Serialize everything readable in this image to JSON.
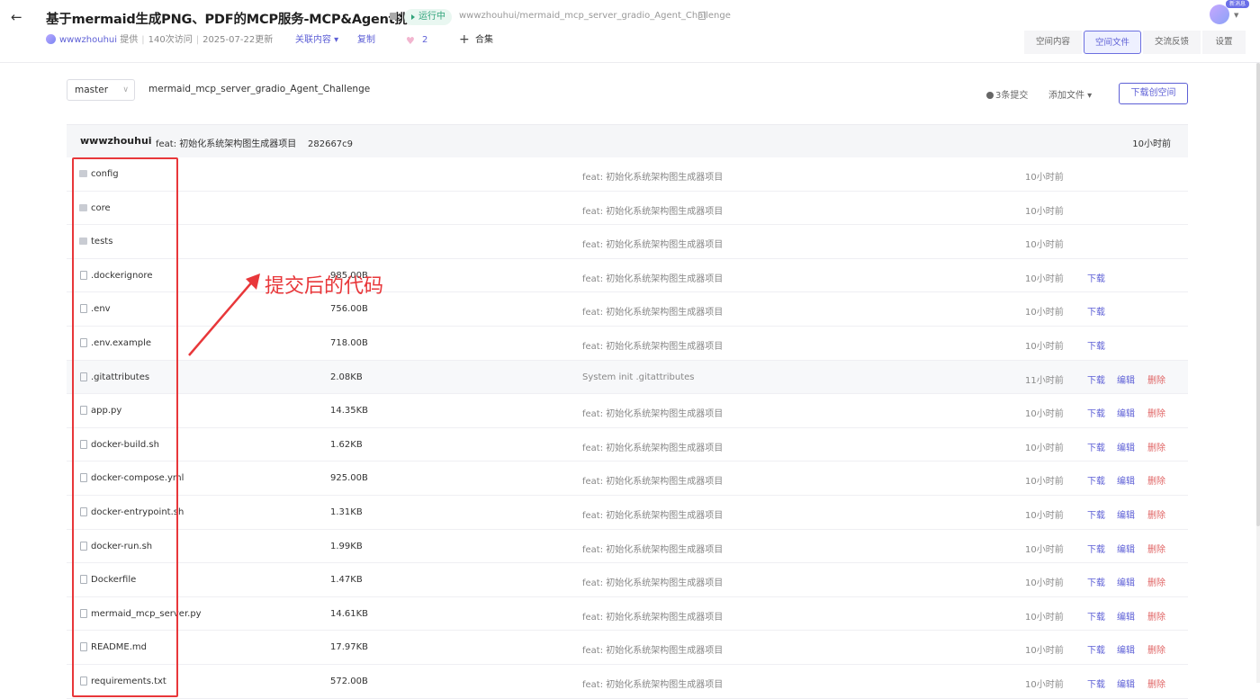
{
  "header": {
    "back_icon": "arrow-left-icon",
    "title": "基于mermaid生成PNG、PDF的MCP服务-MCP&Agent挑战赛",
    "status": "运行中",
    "repo_path": "wwwzhouhui/mermaid_mcp_server_gradio_Agent_Challenge",
    "owner": "wwwzhouhui",
    "provider_suffix": "提供",
    "visits": "140次访问",
    "updated": "2025-07-22更新",
    "related": "关联内容 ▾",
    "copy": "复制",
    "likes": "2",
    "collection": "合集",
    "tabs": [
      {
        "label": "空间内容",
        "active": false
      },
      {
        "label": "空间文件",
        "active": true
      },
      {
        "label": "交流反馈",
        "active": false
      },
      {
        "label": "设置",
        "active": false
      }
    ],
    "new_badge": "新消息"
  },
  "toolbar": {
    "branch": "master",
    "repo_name": "mermaid_mcp_server_gradio_Agent_Challenge",
    "commits": "3条提交",
    "add_file": "添加文件 ▾",
    "download_space": "下载创空间"
  },
  "latest_commit": {
    "author": "wwwzhouhui",
    "message": "feat: 初始化系统架构图生成器项目",
    "hash": "282667c9",
    "time": "10小时前"
  },
  "actions": {
    "download": "下载",
    "edit": "编辑",
    "delete": "删除"
  },
  "files": [
    {
      "name": "config",
      "type": "folder",
      "size": "",
      "message": "feat: 初始化系统架构图生成器项目",
      "time": "10小时前",
      "actions": ""
    },
    {
      "name": "core",
      "type": "folder",
      "size": "",
      "message": "feat: 初始化系统架构图生成器项目",
      "time": "10小时前",
      "actions": ""
    },
    {
      "name": "tests",
      "type": "folder",
      "size": "",
      "message": "feat: 初始化系统架构图生成器项目",
      "time": "10小时前",
      "actions": ""
    },
    {
      "name": ".dockerignore",
      "type": "file",
      "size": "985.00B",
      "message": "feat: 初始化系统架构图生成器项目",
      "time": "10小时前",
      "actions": "d"
    },
    {
      "name": ".env",
      "type": "file",
      "size": "756.00B",
      "message": "feat: 初始化系统架构图生成器项目",
      "time": "10小时前",
      "actions": "d"
    },
    {
      "name": ".env.example",
      "type": "file",
      "size": "718.00B",
      "message": "feat: 初始化系统架构图生成器项目",
      "time": "10小时前",
      "actions": "d"
    },
    {
      "name": ".gitattributes",
      "type": "file",
      "size": "2.08KB",
      "message": "System init .gitattributes",
      "time": "11小时前",
      "actions": "ded",
      "highlight": true
    },
    {
      "name": "app.py",
      "type": "file",
      "size": "14.35KB",
      "message": "feat: 初始化系统架构图生成器项目",
      "time": "10小时前",
      "actions": "ded"
    },
    {
      "name": "docker-build.sh",
      "type": "file",
      "size": "1.62KB",
      "message": "feat: 初始化系统架构图生成器项目",
      "time": "10小时前",
      "actions": "ded"
    },
    {
      "name": "docker-compose.yml",
      "type": "file",
      "size": "925.00B",
      "message": "feat: 初始化系统架构图生成器项目",
      "time": "10小时前",
      "actions": "ded"
    },
    {
      "name": "docker-entrypoint.sh",
      "type": "file",
      "size": "1.31KB",
      "message": "feat: 初始化系统架构图生成器项目",
      "time": "10小时前",
      "actions": "ded"
    },
    {
      "name": "docker-run.sh",
      "type": "file",
      "size": "1.99KB",
      "message": "feat: 初始化系统架构图生成器项目",
      "time": "10小时前",
      "actions": "ded"
    },
    {
      "name": "Dockerfile",
      "type": "file",
      "size": "1.47KB",
      "message": "feat: 初始化系统架构图生成器项目",
      "time": "10小时前",
      "actions": "ded"
    },
    {
      "name": "mermaid_mcp_server.py",
      "type": "file",
      "size": "14.61KB",
      "message": "feat: 初始化系统架构图生成器项目",
      "time": "10小时前",
      "actions": "ded"
    },
    {
      "name": "README.md",
      "type": "file",
      "size": "17.97KB",
      "message": "feat: 初始化系统架构图生成器项目",
      "time": "10小时前",
      "actions": "ded"
    },
    {
      "name": "requirements.txt",
      "type": "file",
      "size": "572.00B",
      "message": "feat: 初始化系统架构图生成器项目",
      "time": "10小时前",
      "actions": "ded"
    }
  ],
  "annotation": {
    "text": "提交后的代码",
    "color": "#e8373a"
  },
  "colors": {
    "accent": "#5d5fd6",
    "danger": "#e06565",
    "status_green": "#30a37a"
  }
}
